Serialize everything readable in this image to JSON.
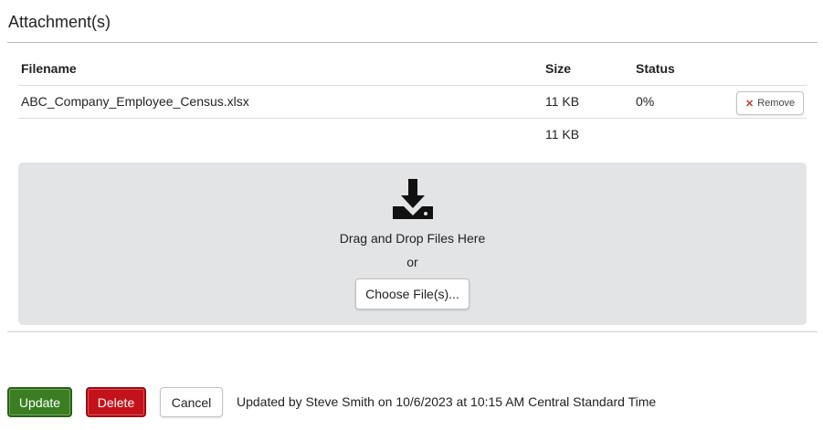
{
  "section": {
    "title": "Attachment(s)"
  },
  "table": {
    "headers": {
      "filename": "Filename",
      "size": "Size",
      "status": "Status"
    },
    "rows": [
      {
        "filename": "ABC_Company_Employee_Census.xlsx",
        "size": "11 KB",
        "status": "0%",
        "remove_icon": "close-icon",
        "remove_label": "Remove"
      }
    ],
    "total_size": "11 KB"
  },
  "dropzone": {
    "icon": "download-icon",
    "drag_text": "Drag and Drop Files Here",
    "or_text": "or",
    "choose_label": "Choose File(s)..."
  },
  "footer": {
    "update_label": "Update",
    "delete_label": "Delete",
    "cancel_label": "Cancel",
    "updated_text": "Updated by Steve Smith on 10/6/2023 at 10:15 AM Central Standard Time"
  },
  "colors": {
    "update": "#3a7d23",
    "delete": "#c4121a",
    "dropzone_bg": "#e2e4e6",
    "remove_x": "#c0392b"
  }
}
